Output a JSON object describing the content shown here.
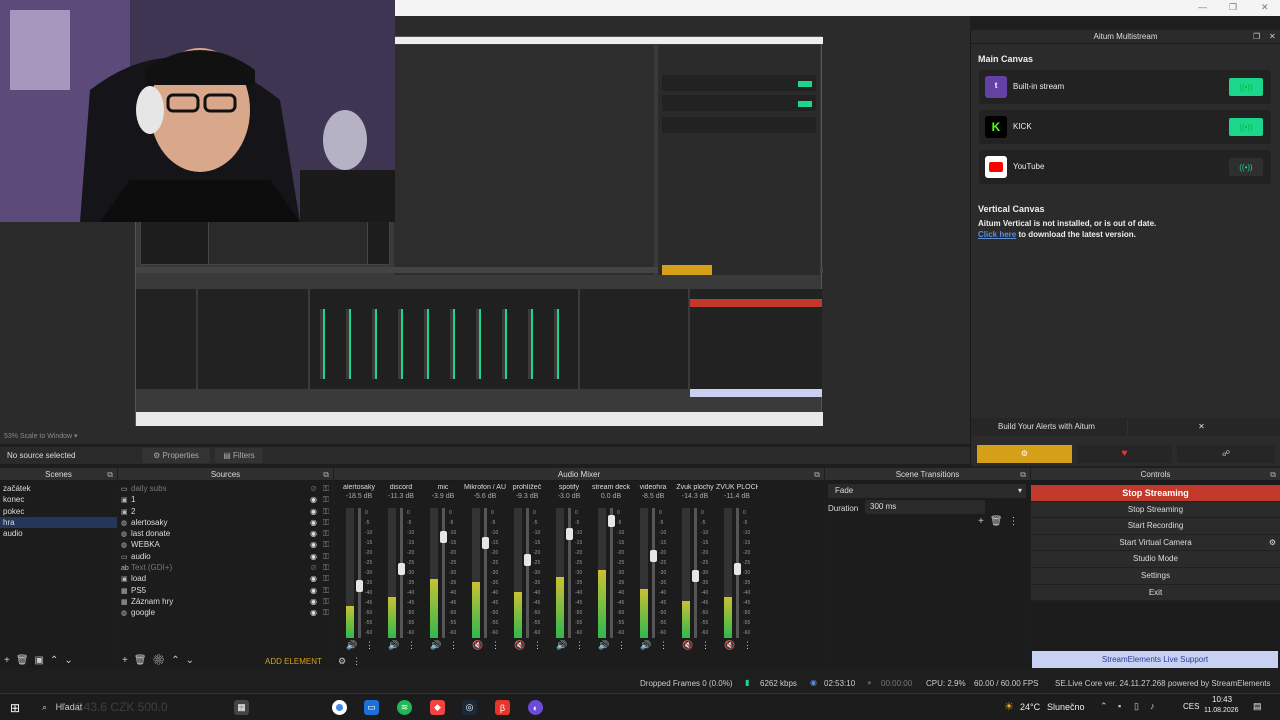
{
  "window": {
    "minimize": "—",
    "maximize": "❐",
    "close": "✕"
  },
  "preview": {
    "scale_label": "53% Scale to Window"
  },
  "properties_bar": {
    "no_source": "No source selected",
    "properties": "Properties",
    "filters": "Filters"
  },
  "multistream": {
    "title": "Aitum Multistream",
    "main_canvas": "Main Canvas",
    "services": [
      {
        "name": "Built-in stream",
        "icon": "twitch-icon",
        "active": true
      },
      {
        "name": "KICK",
        "icon": "kick-icon",
        "active": true
      },
      {
        "name": "YouTube",
        "icon": "youtube-icon",
        "active": false
      }
    ],
    "vertical_canvas": "Vertical Canvas",
    "vertical_msg": "Aitum Vertical is not installed, or is out of date.",
    "click_here": "Click here",
    "download_msg": " to download the latest version.",
    "build_alerts": "Build Your Alerts with Aitum",
    "close_x": "✕"
  },
  "scenes": {
    "title": "Scenes",
    "items": [
      "začátek",
      "konec",
      "pokec",
      "hra",
      "audio"
    ],
    "selected": 3
  },
  "sources": {
    "title": "Sources",
    "items": [
      {
        "name": "daily subs",
        "icon": "folder",
        "dim": true
      },
      {
        "name": "1",
        "icon": "image",
        "dim": false
      },
      {
        "name": "2",
        "icon": "image",
        "dim": false
      },
      {
        "name": "alertosaky",
        "icon": "globe",
        "dim": false
      },
      {
        "name": "last donate",
        "icon": "globe",
        "dim": false
      },
      {
        "name": "WEBKA",
        "icon": "globe",
        "dim": false
      },
      {
        "name": "audio",
        "icon": "folder",
        "dim": false
      },
      {
        "name": "Text (GDI+)",
        "icon": "text",
        "dim": true
      },
      {
        "name": "load",
        "icon": "image",
        "dim": false
      },
      {
        "name": "PS5",
        "icon": "camera",
        "dim": false
      },
      {
        "name": "Záznam hry",
        "icon": "camera",
        "dim": false
      },
      {
        "name": "google",
        "icon": "globe",
        "dim": false
      }
    ],
    "add_element": "ADD ELEMENT"
  },
  "mixer": {
    "title": "Audio Mixer",
    "channels": [
      {
        "name": "alertosaky",
        "db": "-18.5 dB",
        "level": 0.45,
        "muted": false
      },
      {
        "name": "discord",
        "db": "-11.3 dB",
        "level": 0.58,
        "muted": false
      },
      {
        "name": "mic",
        "db": "-3.9 dB",
        "level": 0.82,
        "muted": false
      },
      {
        "name": "Mikrofon / AUX",
        "db": "-5.6 dB",
        "level": 0.78,
        "muted": true
      },
      {
        "name": "prohlížeč",
        "db": "-9.3 dB",
        "level": 0.65,
        "muted": true
      },
      {
        "name": "spotify",
        "db": "-3.0 dB",
        "level": 0.85,
        "muted": false
      },
      {
        "name": "stream deck",
        "db": "0.0 dB",
        "level": 0.95,
        "muted": false
      },
      {
        "name": "videohra",
        "db": "-8.5 dB",
        "level": 0.68,
        "muted": false
      },
      {
        "name": "Zvuk plochy",
        "db": "-14.3 dB",
        "level": 0.52,
        "muted": true
      },
      {
        "name": "ZVUK PLOCHY",
        "db": "-11.4 dB",
        "level": 0.58,
        "muted": true
      }
    ],
    "scale": [
      "0",
      "-5",
      "-10",
      "-15",
      "-20",
      "-25",
      "-30",
      "-35",
      "-40",
      "-45",
      "-50",
      "-55",
      "-60"
    ]
  },
  "transitions": {
    "title": "Scene Transitions",
    "type": "Fade",
    "duration_label": "Duration",
    "duration": "300 ms"
  },
  "controls": {
    "title": "Controls",
    "stop_streaming": "Stop Streaming",
    "items": [
      "Stop Streaming",
      "Start Recording",
      "Start Virtual Camera",
      "Studio Mode",
      "Settings",
      "Exit"
    ],
    "live_support": "StreamElements Live Support"
  },
  "status": {
    "dropped": "Dropped Frames 0 (0.0%)",
    "kbps": "6262 kbps",
    "stream_time": "02:53:10",
    "rec_time": "00:00:00",
    "cpu": "CPU: 2.9%",
    "fps": "60.00 / 60.00 FPS",
    "version": "SE.Live Core ver. 24.11.27.268 powered by StreamElements"
  },
  "taskbar": {
    "search": "Hľadat",
    "weather_temp": "24°C",
    "weather_desc": "Slunečno",
    "lang": "CES",
    "time": "10:43",
    "date": "11.08.2026",
    "ticker": "C43.6 CZK 500.0"
  },
  "colors": {
    "accent_green": "#1bd68b",
    "stop_red": "#c0392b",
    "aitum_gold": "#d4a017",
    "live_support_bg": "#c9d1f2"
  }
}
